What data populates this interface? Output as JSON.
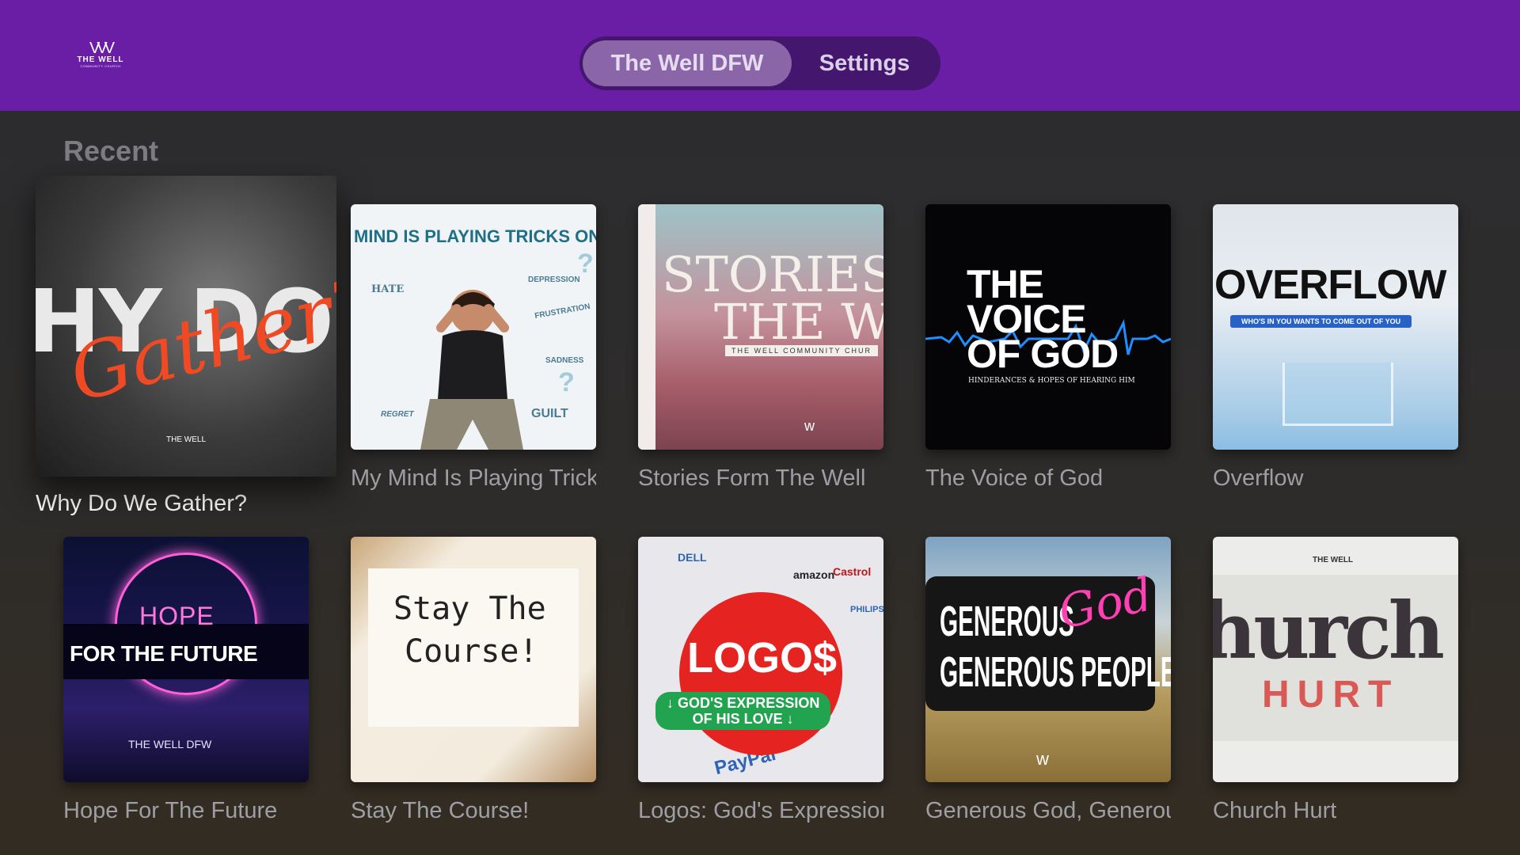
{
  "header": {
    "logo": {
      "mark": "VVV",
      "name": "THE WELL",
      "subtitle": "COMMUNITY CHURCH"
    },
    "tabs": [
      {
        "label": "The Well DFW",
        "active": true
      },
      {
        "label": "Settings",
        "active": false
      }
    ]
  },
  "section": {
    "title": "Recent"
  },
  "colors": {
    "topbar": "#6a1ea6",
    "tab_active": "#8a66a8",
    "focused_caption": "#ffffff"
  },
  "cards": [
    {
      "caption": "Why Do We Gather?",
      "focused": true,
      "art": {
        "big": "HY DO W",
        "script": "Gather?",
        "foot": "THE WELL"
      }
    },
    {
      "caption": "My Mind Is Playing Tricks On Me",
      "art": {
        "title": "MIND IS PLAYING TRICKS ON",
        "words": [
          "HATE",
          "DEPRESSION",
          "FRUSTRATION",
          "SADNESS",
          "GUILT",
          "REGRET"
        ]
      }
    },
    {
      "caption": "Stories Form The Well",
      "art": {
        "line1": "STORIES FI",
        "line2": "THE WEI",
        "line3": "THE WELL COMMUNITY CHUR"
      }
    },
    {
      "caption": "The Voice of God",
      "art": {
        "line1": "THE",
        "line2": "VOICE",
        "line3": "OF GOD",
        "sub": "HINDERANCES & HOPES OF HEARING HIM"
      }
    },
    {
      "caption": "Overflow",
      "art": {
        "title": "OVERFLOW",
        "band": "WHO'S IN YOU WANTS TO COME OUT OF YOU"
      }
    },
    {
      "caption": "Hope For The Future",
      "art": {
        "line1": "HOPE",
        "line2": "FOR THE FUTURE",
        "line3": "THE WELL DFW"
      }
    },
    {
      "caption": "Stay The Course!",
      "art": {
        "line1": "Stay The",
        "line2": "Course!"
      }
    },
    {
      "caption": "Logos: God's Expression Of His Love",
      "art": {
        "title": "LOGO$",
        "band1": "↓ GOD'S EXPRESSION",
        "band2": "OF HIS LOVE ↓",
        "brands": [
          "DELL",
          "amazon",
          "Castrol",
          "PayPal",
          "PHILIPS"
        ]
      }
    },
    {
      "caption": "Generous God, Generous People",
      "art": {
        "line1": "GENEROUS",
        "line2": "GENEROUS PEOPLE",
        "script": "God"
      }
    },
    {
      "caption": "Church Hurt",
      "art": {
        "top": "THE WELL",
        "line1": "hurch",
        "line2": "HURT"
      }
    }
  ]
}
